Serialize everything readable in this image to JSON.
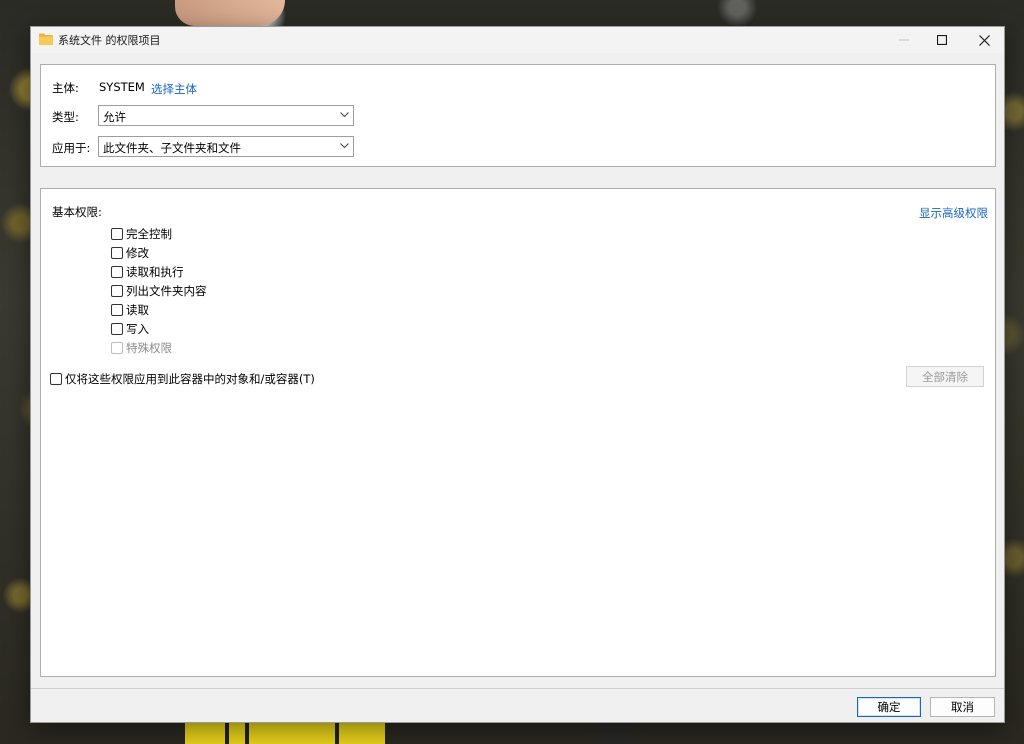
{
  "window": {
    "title": "系统文件 的权限项目",
    "controls": {
      "minimize": "minimize-icon",
      "maximize": "maximize-icon",
      "close": "close-icon"
    }
  },
  "top_panel": {
    "principal_label": "主体:",
    "principal_value": "SYSTEM",
    "select_principal_link": "选择主体",
    "type_label": "类型:",
    "type_value": "允许",
    "applies_to_label": "应用于:",
    "applies_to_value": "此文件夹、子文件夹和文件"
  },
  "permissions": {
    "heading": "基本权限:",
    "show_advanced_link": "显示高级权限",
    "items": [
      {
        "label": "完全控制",
        "checked": false,
        "enabled": true
      },
      {
        "label": "修改",
        "checked": false,
        "enabled": true
      },
      {
        "label": "读取和执行",
        "checked": false,
        "enabled": true
      },
      {
        "label": "列出文件夹内容",
        "checked": false,
        "enabled": true
      },
      {
        "label": "读取",
        "checked": false,
        "enabled": true
      },
      {
        "label": "写入",
        "checked": false,
        "enabled": true
      },
      {
        "label": "特殊权限",
        "checked": false,
        "enabled": false
      }
    ],
    "apply_only_label": "仅将这些权限应用到此容器中的对象和/或容器(T)",
    "clear_all_button": "全部清除"
  },
  "footer": {
    "ok_button": "确定",
    "cancel_button": "取消"
  },
  "colors": {
    "link": "#1a66c2",
    "folder_icon": "#e8b33a",
    "disabled_text": "#8c8c8c"
  }
}
